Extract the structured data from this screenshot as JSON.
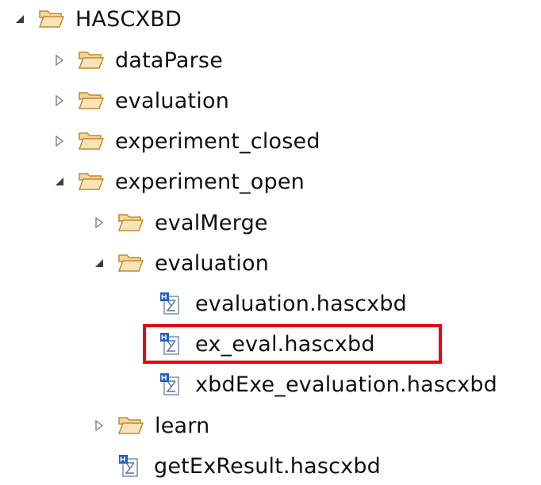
{
  "tree": {
    "items": [
      {
        "label": "HASCXBD",
        "type": "folder",
        "state": "expanded"
      },
      {
        "label": "dataParse",
        "type": "folder",
        "state": "collapsed"
      },
      {
        "label": "evaluation",
        "type": "folder",
        "state": "collapsed"
      },
      {
        "label": "experiment_closed",
        "type": "folder",
        "state": "collapsed"
      },
      {
        "label": "experiment_open",
        "type": "folder",
        "state": "expanded"
      },
      {
        "label": "evalMerge",
        "type": "folder",
        "state": "collapsed"
      },
      {
        "label": "evaluation",
        "type": "folder",
        "state": "expanded"
      },
      {
        "label": "evaluation.hascxbd",
        "type": "file"
      },
      {
        "label": "ex_eval.hascxbd",
        "type": "file",
        "highlighted": true
      },
      {
        "label": "xbdExe_evaluation.hascxbd",
        "type": "file"
      },
      {
        "label": "learn",
        "type": "folder",
        "state": "collapsed"
      },
      {
        "label": "getExResult.hascxbd",
        "type": "file"
      }
    ]
  },
  "colors": {
    "highlight_border": "#e8000e",
    "folder_fill": "#f4d59a",
    "folder_stroke": "#c08a2c",
    "file_icon_blue": "#1f5fbf",
    "toggle_grey": "#8c8c8c"
  },
  "icons": {
    "expanded_toggle": "triangle-down-right-icon",
    "collapsed_toggle": "triangle-right-outline-icon",
    "folder": "open-folder-icon",
    "file": "hascxbd-file-icon"
  }
}
